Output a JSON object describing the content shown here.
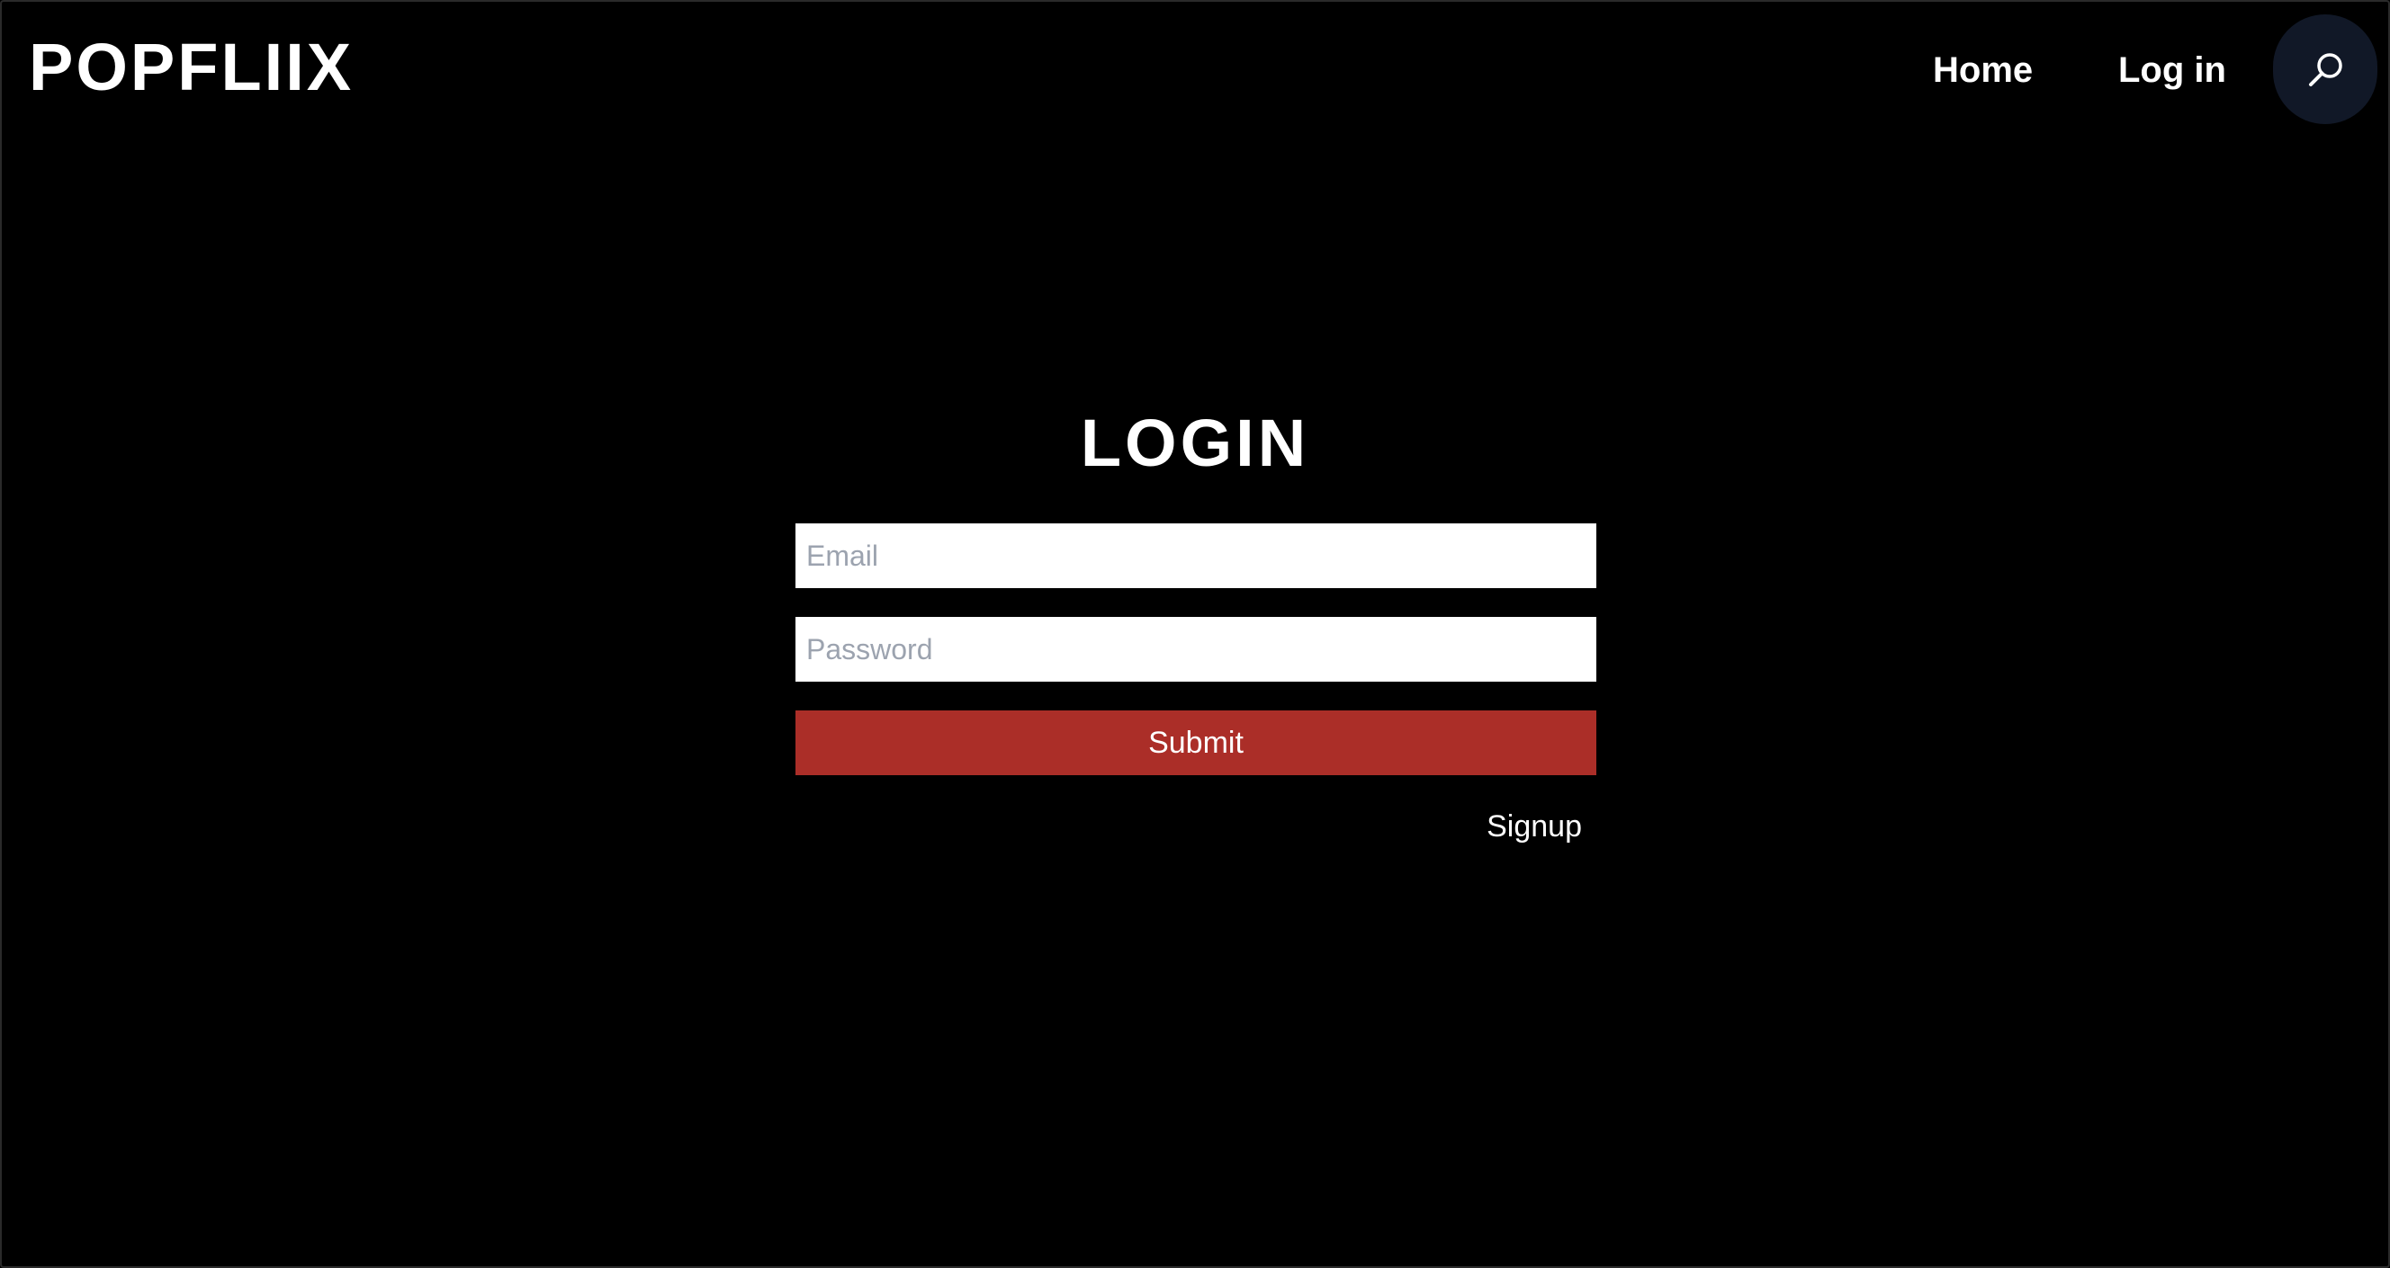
{
  "header": {
    "logo": "POPFLIIX",
    "nav": {
      "home_label": "Home",
      "login_label": "Log in"
    },
    "search_icon": "search-icon"
  },
  "login_form": {
    "title": "LOGIN",
    "email": {
      "value": "",
      "placeholder": "Email"
    },
    "password": {
      "value": "",
      "placeholder": "Password"
    },
    "submit_label": "Submit",
    "signup_label": "Signup"
  },
  "colors": {
    "background": "#000000",
    "text": "#ffffff",
    "submit_button": "#ab2e28",
    "search_button": "#111827",
    "placeholder": "#9ca3af"
  }
}
